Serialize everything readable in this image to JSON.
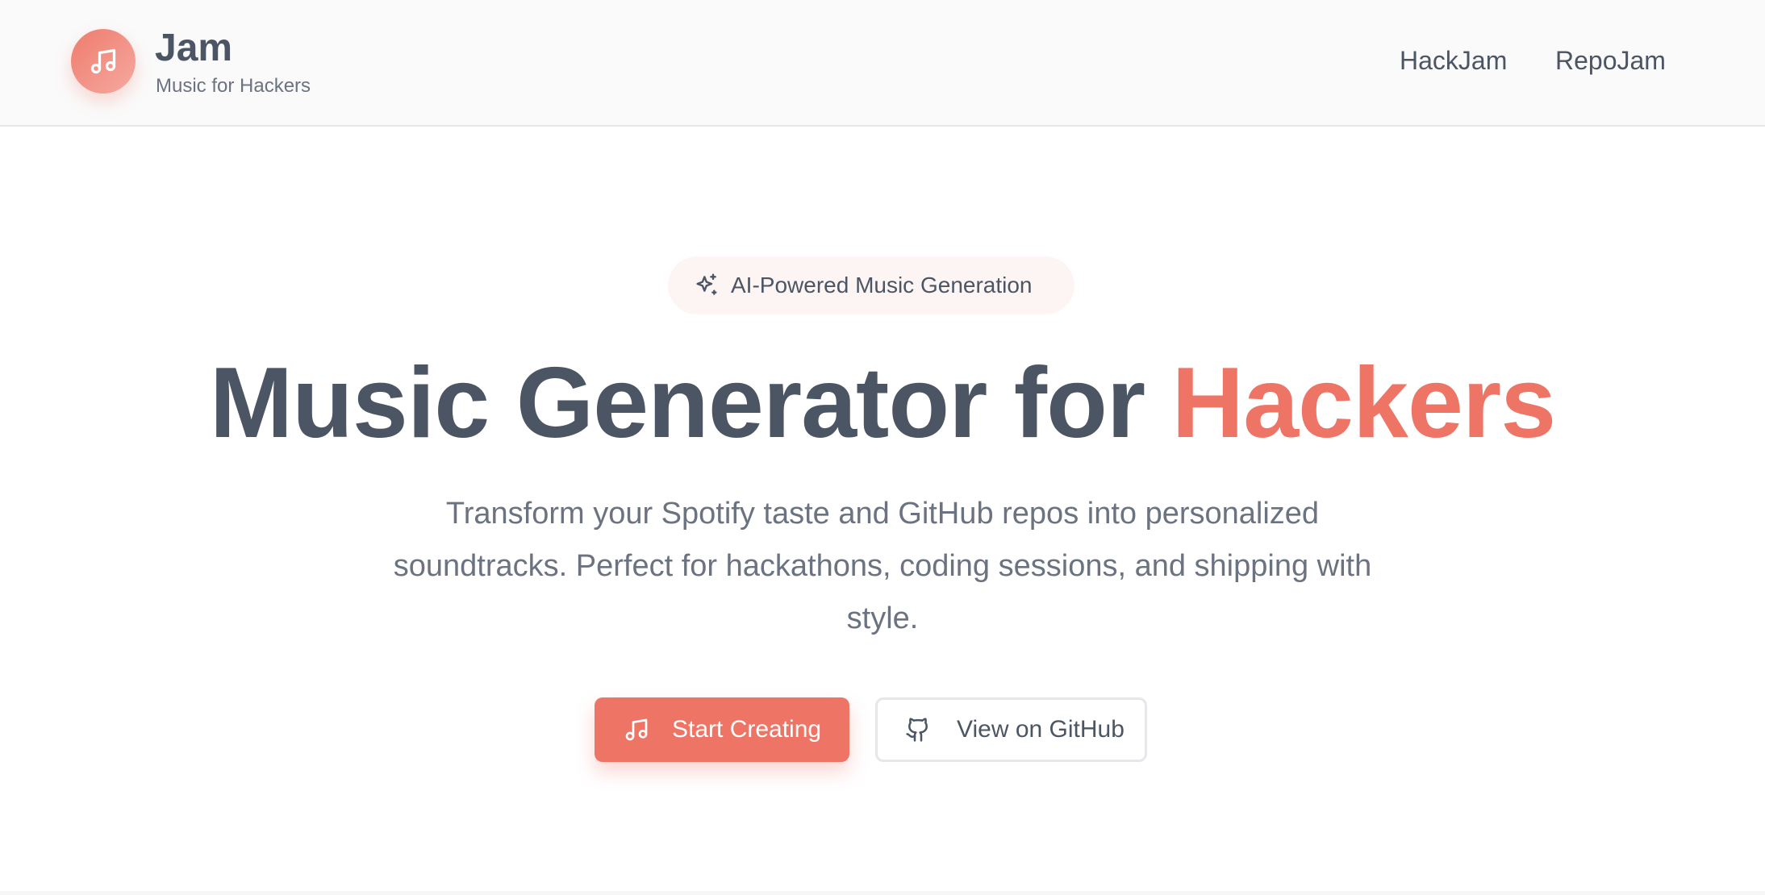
{
  "header": {
    "brand_name": "Jam",
    "brand_tagline": "Music for Hackers",
    "logo_icon": "music-note-icon",
    "nav": [
      {
        "label": "HackJam"
      },
      {
        "label": "RepoJam"
      }
    ]
  },
  "hero": {
    "badge": {
      "icon": "sparkles-icon",
      "text": "AI-Powered Music Generation"
    },
    "headline_main": "Music Generator for ",
    "headline_accent": "Hackers",
    "subtitle": "Transform your Spotify taste and GitHub repos into personalized soundtracks. Perfect for hackathons, coding sessions, and shipping with style.",
    "primary_button": {
      "label": "Start Creating",
      "icon": "music-note-icon"
    },
    "secondary_button": {
      "label": "View on GitHub",
      "icon": "github-icon"
    }
  },
  "colors": {
    "accent": "#ee7566",
    "text_dark": "#4b5563",
    "text_muted": "#6b7280",
    "header_bg": "#fafafa",
    "badge_bg": "#fdf5f4"
  }
}
